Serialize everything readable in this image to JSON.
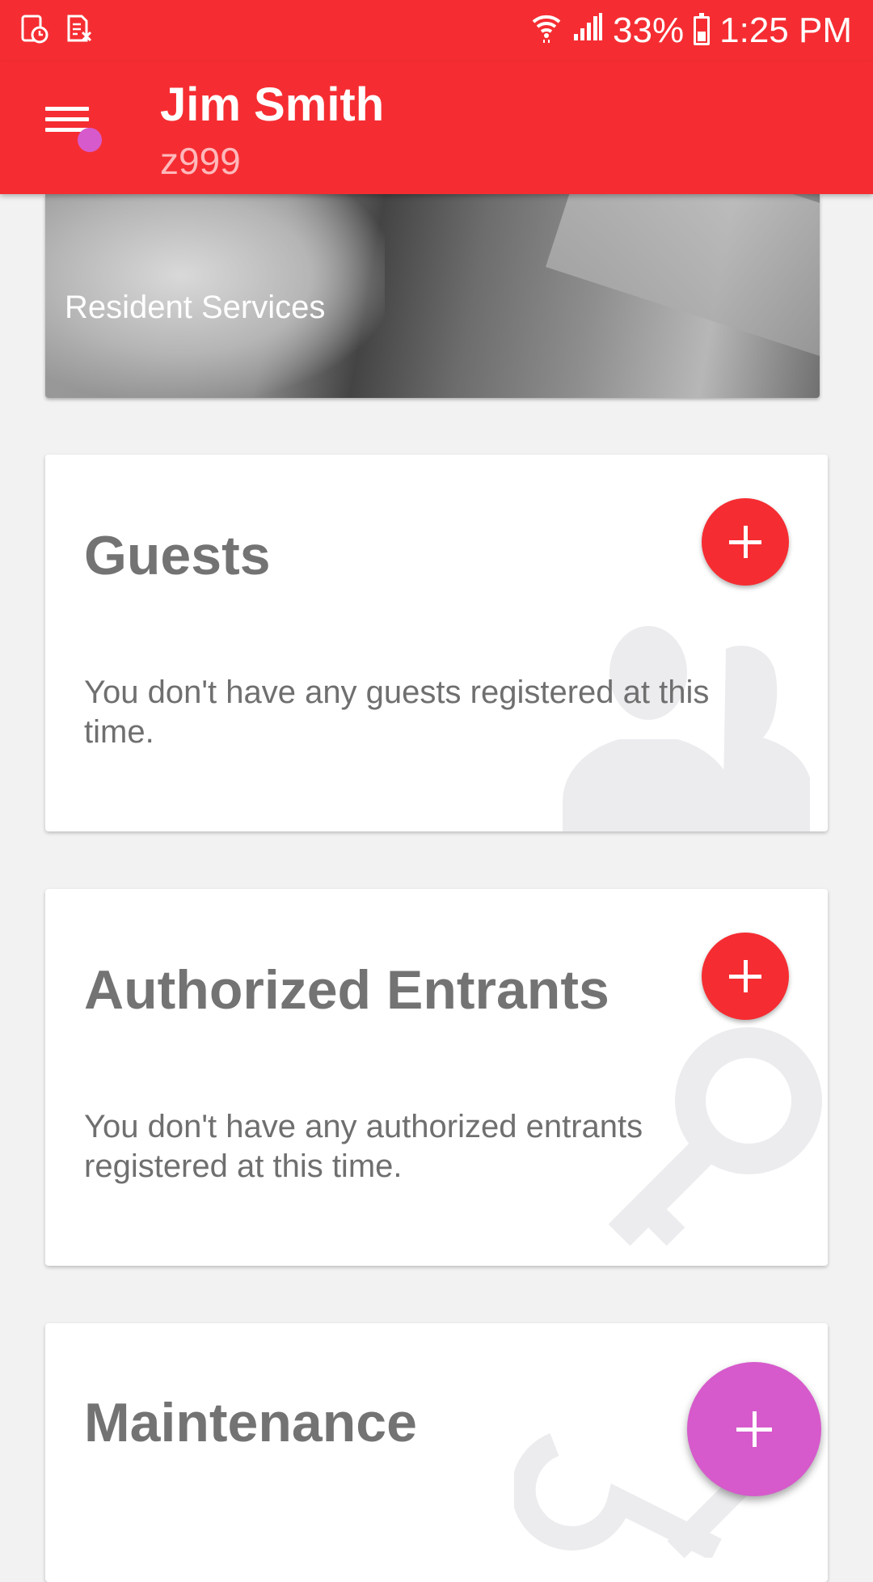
{
  "status_bar": {
    "battery_percent": "33%",
    "time": "1:25 PM",
    "icons": [
      "calendar-clock-icon",
      "sim-off-icon",
      "wifi-icon",
      "signal-icon",
      "battery-icon"
    ]
  },
  "app_bar": {
    "name": "Jim Smith",
    "user_id": "z999",
    "menu_icon": "hamburger-menu-icon"
  },
  "banner": {
    "title": "Resident Services"
  },
  "cards": {
    "guests": {
      "title": "Guests",
      "text": "You don't have any guests registered at this time.",
      "bg_icon": "people-icon"
    },
    "entrants": {
      "title": "Authorized Entrants",
      "text": "You don't have any authorized entrants registered at this time.",
      "bg_icon": "key-icon"
    },
    "maintenance": {
      "title": "Maintenance",
      "bg_icon": "wrench-icon"
    }
  },
  "colors": {
    "primary": "#f52d32",
    "accent": "#d65acb",
    "background": "#f2f2f2"
  }
}
